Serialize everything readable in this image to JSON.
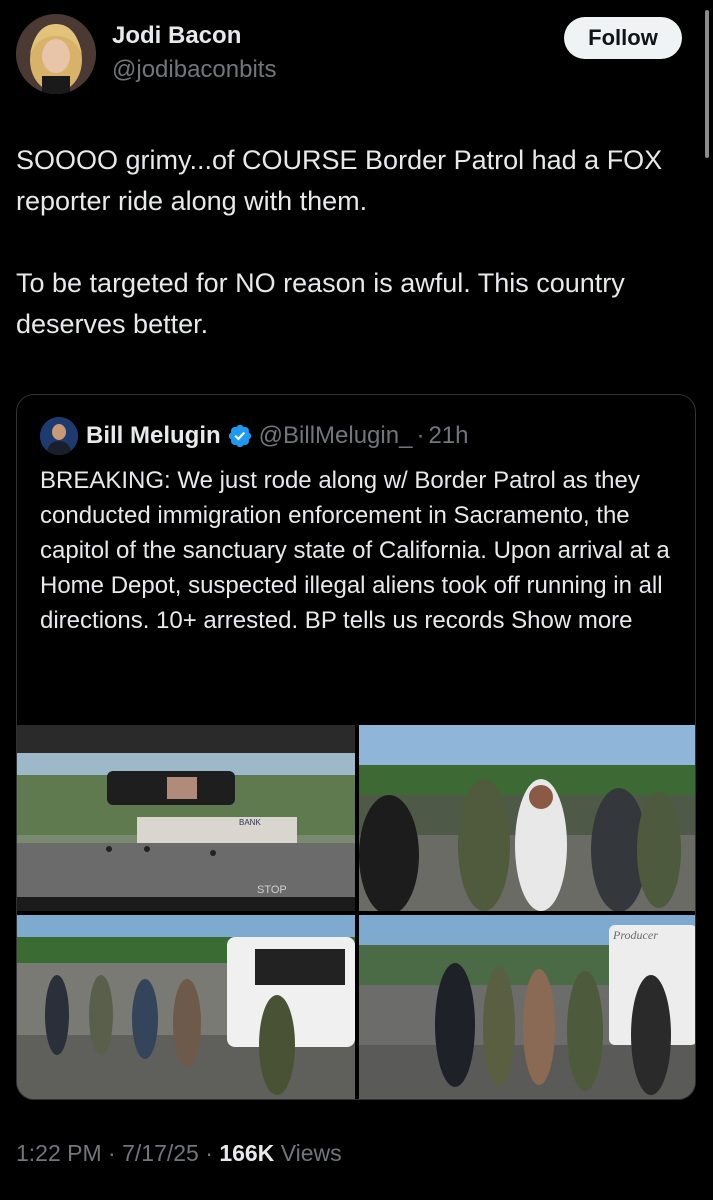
{
  "author": {
    "name": "Jodi Bacon",
    "handle": "@jodibaconbits"
  },
  "follow_label": "Follow",
  "tweet": {
    "paragraph1": "SOOOO grimy...of COURSE Border Patrol had a FOX reporter ride along with them.",
    "paragraph2": "To be targeted for NO reason is awful.  This country deserves better."
  },
  "quote": {
    "name": "Bill Melugin",
    "handle": "@BillMelugin_",
    "separator": "·",
    "time": "21h",
    "text": "BREAKING: We just rode along w/ Border Patrol as they conducted immigration enforcement in Sacramento, the capitol of the sanctuary state of California. Upon arrival at a Home Depot, suspected illegal aliens took off running in all directions. 10+ arrested. BP tells us records",
    "show_more": "Show more",
    "photo_text": {
      "bank_sign": "BANK",
      "stop": "STOP",
      "producer": "Producer"
    }
  },
  "meta": {
    "time": "1:22 PM",
    "sep": "·",
    "date": "7/17/25",
    "views_count": "166K",
    "views_label": "Views"
  },
  "colors": {
    "background": "#000000",
    "text": "#e7e9ea",
    "muted": "#71767b",
    "verified": "#1d9bf0",
    "border": "#2f3336"
  }
}
